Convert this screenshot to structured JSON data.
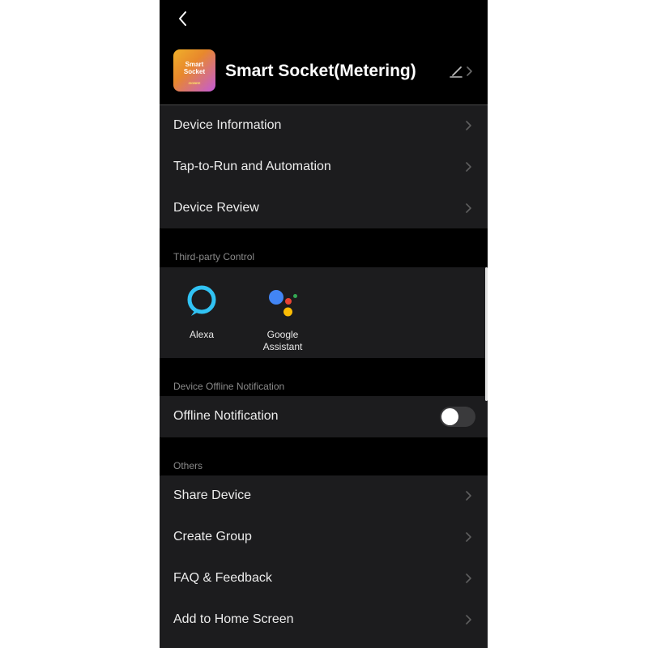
{
  "header": {
    "title": "Smart Socket(Metering)",
    "thumbnail_text": [
      "Smart",
      "Socket",
      "ZIGBEE"
    ]
  },
  "menu_top": [
    {
      "label": "Device Information"
    },
    {
      "label": "Tap-to-Run and Automation"
    },
    {
      "label": "Device Review"
    }
  ],
  "third_party": {
    "section_label": "Third-party Control",
    "items": [
      {
        "label": "Alexa",
        "icon": "alexa-icon"
      },
      {
        "label": "Google\nAssistant",
        "icon": "google-assistant-icon"
      }
    ]
  },
  "offline": {
    "section_label": "Device Offline Notification",
    "row_label": "Offline Notification",
    "toggle_on": false
  },
  "others": {
    "section_label": "Others",
    "items": [
      {
        "label": "Share Device"
      },
      {
        "label": "Create Group"
      },
      {
        "label": "FAQ & Feedback"
      },
      {
        "label": "Add to Home Screen"
      }
    ]
  },
  "colors": {
    "background": "#000000",
    "card": "#1c1c1e",
    "alexa": "#31c3f4",
    "google_blue": "#4285f4",
    "google_red": "#ea4335",
    "google_yellow": "#fbbc05",
    "google_green": "#34a853"
  }
}
